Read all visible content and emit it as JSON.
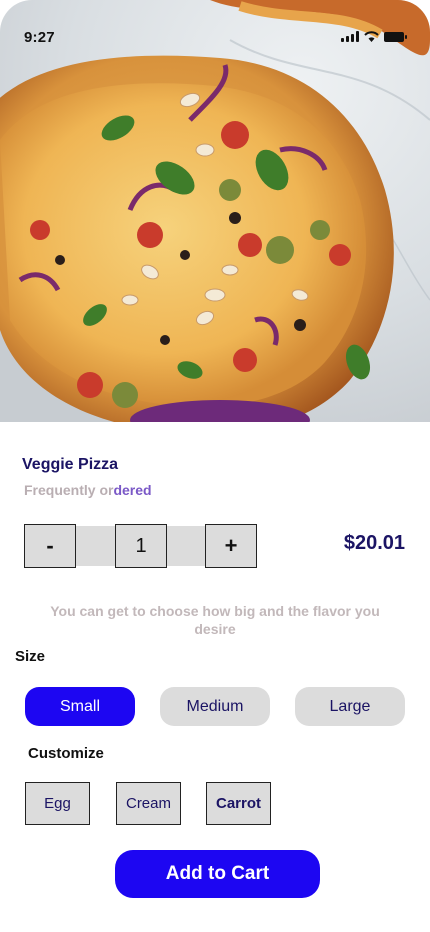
{
  "status_bar": {
    "time": "9:27"
  },
  "product": {
    "name": "Veggie Pizza",
    "tag_prefix": "Frequently or",
    "tag_accent": "dered",
    "price": "$20.01",
    "description": "You can get to choose how big and the flavor you desire"
  },
  "quantity": {
    "minus_label": "-",
    "value": "1",
    "plus_label": "+"
  },
  "size": {
    "label": "Size",
    "options": [
      "Small",
      "Medium",
      "Large"
    ],
    "selected": "Small"
  },
  "customize": {
    "label": "Customize",
    "options": [
      "Egg",
      "Cream",
      "Carrot"
    ]
  },
  "actions": {
    "add_to_cart": "Add to Cart"
  },
  "colors": {
    "accent": "#1d06f2",
    "title": "#1b1464",
    "muted_text": "#c2b8ba",
    "button_gray": "#dcdcdc"
  }
}
